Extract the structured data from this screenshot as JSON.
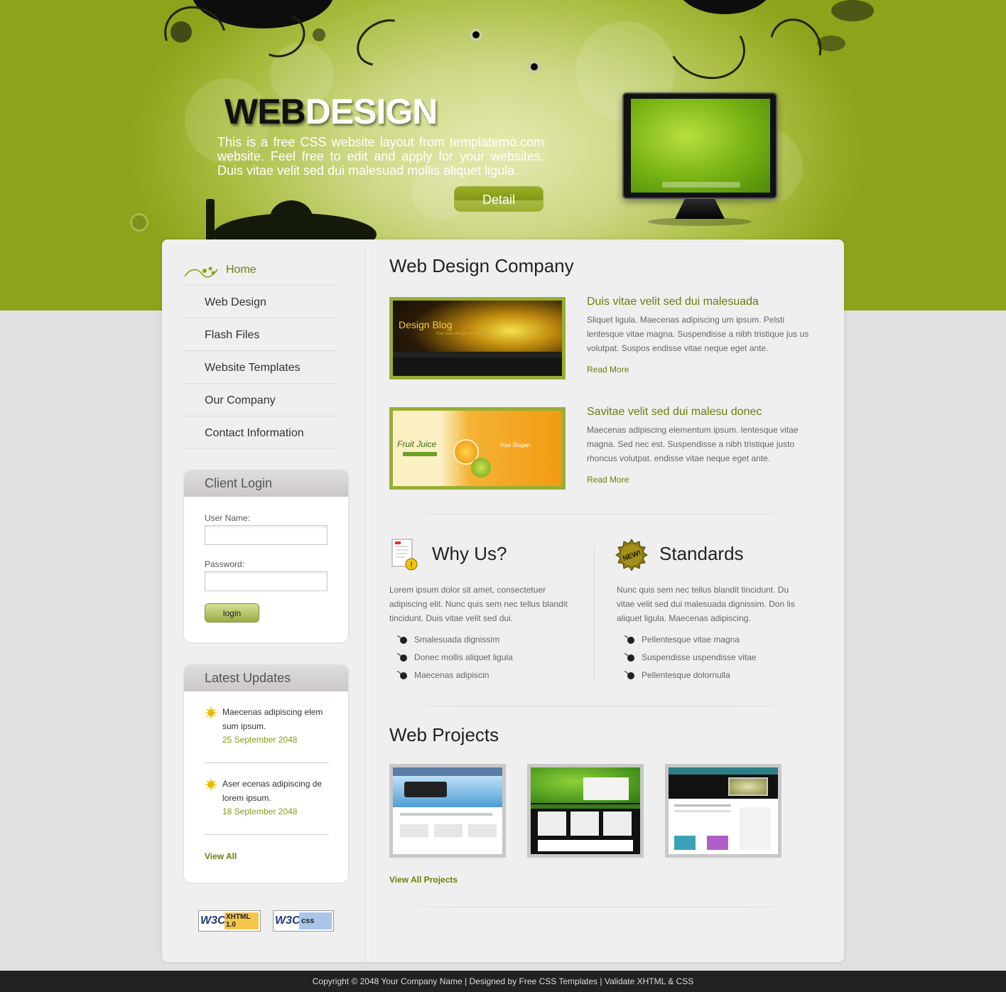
{
  "header": {
    "logo_dark": "WEB",
    "logo_light": "DESIGN",
    "intro": "This is a free CSS website layout from templatemo.com website. Feel free to edit and apply for your websites. Duis vitae velit sed dui malesuad mollis aliquet ligula.",
    "detail_button": "Detail"
  },
  "nav": {
    "items": [
      {
        "label": "Home",
        "active": true
      },
      {
        "label": "Web Design"
      },
      {
        "label": "Flash Files"
      },
      {
        "label": "Website Templates"
      },
      {
        "label": "Our Company"
      },
      {
        "label": "Contact Information"
      }
    ]
  },
  "login": {
    "title": "Client Login",
    "username_label": "User Name:",
    "password_label": "Password:",
    "button": "login"
  },
  "updates": {
    "title": "Latest Updates",
    "items": [
      {
        "text": "Maecenas adipiscing elem sum ipsum.",
        "date": "25 September 2048"
      },
      {
        "text": "Aser ecenas adipiscing de lorem ipsum.",
        "date": "18 September 2048"
      }
    ],
    "view_all": "View All"
  },
  "badges": {
    "xhtml": {
      "w3c": "W3C",
      "label": "XHTML 1.0"
    },
    "css": {
      "w3c": "W3C",
      "label": "css"
    }
  },
  "company": {
    "title": "Web Design Company",
    "posts": [
      {
        "title": "Duis vitae velit sed dui malesuada",
        "body": "Sliquet ligula. Maecenas adipiscing um ipsum. Pelsti lentesque vitae magna. Suspendisse a nibh tristique jus us volutpat. Suspos endisse vitae neque eget ante.",
        "read_more": "Read More",
        "thumb": {
          "heading": "Design Blog",
          "tagline": "Your web design resources"
        }
      },
      {
        "title": "Savitae velit sed dui malesu donec",
        "body": "Maecenas adipiscing elementum ipsum. lentesque vitae magna. Sed nec est. Suspendisse a nibh tristique justo rhoncus volutpat. endisse vitae neque eget ante.",
        "read_more": "Read More",
        "thumb": {
          "heading": "Fruit Juice",
          "tagline": "Your Slogan"
        }
      }
    ]
  },
  "why_us": {
    "title": "Why Us?",
    "text": "Lorem ipsum dolor sit amet, consectetuer adipiscing elit. Nunc quis sem nec tellus blandit tincidunt. Duis vitae velit sed dui.",
    "bullets": [
      "Smalesuada dignissim",
      "Donec mollis aliquet ligula",
      "Maecenas adipiscin"
    ]
  },
  "standards": {
    "title": "Standards",
    "text": "Nunc quis sem nec tellus blandit tincidunt. Du vitae velit sed dui malesuada dignissim. Don lis aliquet ligula. Maecenas adipiscing.",
    "bullets": [
      "Pellentesque vitae magna",
      "Suspendisse uspendisse vitae",
      "Pellentesque dolornulla"
    ],
    "badge": "NEW!"
  },
  "projects": {
    "title": "Web Projects",
    "view_all": "View All Projects"
  },
  "footer": {
    "text": "Copyright © 2048 Your Company Name | Designed by Free CSS Templates | Validate XHTML & CSS"
  },
  "colors": {
    "accent_green": "#8ea21b",
    "link_green": "#6b7e0a",
    "panel": "#efefef",
    "footer": "#222222"
  }
}
